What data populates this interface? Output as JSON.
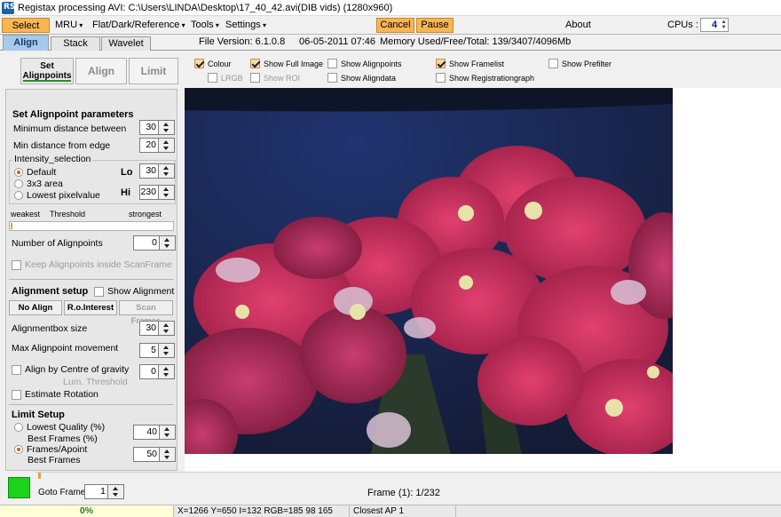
{
  "window": {
    "title": "Registax processing AVI: C:\\Users\\LINDA\\Desktop\\17_40_42.avi(DIB vids) (1280x960)"
  },
  "menu": {
    "select": "Select",
    "mru": "MRU",
    "flat": "Flat/Dark/Reference",
    "tools": "Tools",
    "settings": "Settings",
    "cancel": "Cancel",
    "pause": "Pause",
    "about": "About",
    "cpus_label": "CPUs :",
    "cpus_value": "4"
  },
  "tabs": {
    "align": "Align",
    "stack": "Stack",
    "wavelet": "Wavelet"
  },
  "info": {
    "version": "File Version: 6.1.0.8",
    "date": "06-05-2011 07:46",
    "memory": "Memory Used/Free/Total: 139/3407/4096Mb"
  },
  "subtabs": {
    "set_alignpoints_1": "Set",
    "set_alignpoints_2": "Alignpoints",
    "align": "Align",
    "limit": "Limit"
  },
  "options": {
    "colour": "Colour",
    "lrgb": "LRGB",
    "show_full_image": "Show Full Image",
    "show_roi": "Show ROI",
    "show_alignpoints": "Show Alignpoints",
    "show_aligndata": "Show Aligndata",
    "show_framelist": "Show Framelist",
    "show_registrationgraph": "Show Registrationgraph",
    "show_prefilter": "Show Prefilter"
  },
  "panel": {
    "set_ap_header": "Set Alignpoint parameters",
    "min_dist_between": "Minimum distance between",
    "min_dist_between_val": "30",
    "min_dist_edge": "Min distance from edge",
    "min_dist_edge_val": "20",
    "intensity_selection": "Intensity_selection",
    "default": "Default",
    "area3x3": "3x3 area",
    "lowest_pixel": "Lowest pixelvalue",
    "lo": "Lo",
    "lo_val": "30",
    "hi": "Hi",
    "hi_val": "230",
    "weakest": "weakest",
    "threshold": "Threshold",
    "strongest": "strongest",
    "num_alignpoints": "Number of Alignpoints",
    "num_alignpoints_val": "0",
    "keep_inside": "Keep Alignpoints inside ScanFrame",
    "alignment_setup": "Alignment setup",
    "show_alignment": "Show Alignment",
    "no_align": "No Align",
    "ro_interest": "R.o.Interest",
    "scan_frames": "Scan Frames",
    "alignbox_size": "Alignmentbox size",
    "alignbox_size_val": "30",
    "max_ap_movement": "Max Alignpoint movement",
    "max_ap_movement_val": "5",
    "align_cog": "Align by Centre of gravity",
    "align_cog_val": "0",
    "lum_threshold": "Lum. Threshold",
    "estimate_rotation": "Estimate Rotation",
    "limit_setup": "Limit Setup",
    "lowest_quality": "Lowest Quality (%)",
    "best_frames_pct": "Best Frames (%)",
    "lq_val": "40",
    "frames_apoint": "Frames/Apoint",
    "best_frames": "Best Frames",
    "fa_val": "50"
  },
  "bottom": {
    "goto_frame": "Goto Frame",
    "goto_val": "1",
    "frame_info": "Frame (1): 1/232"
  },
  "status": {
    "progress": "0%",
    "pixel": "X=1266 Y=650 I=132 RGB=185 98 165",
    "closest": "Closest AP 1"
  },
  "colors": {
    "accent_orange": "#f7b556",
    "tab_active": "#a7c9ea",
    "indicator_green": "#1ad31a"
  }
}
